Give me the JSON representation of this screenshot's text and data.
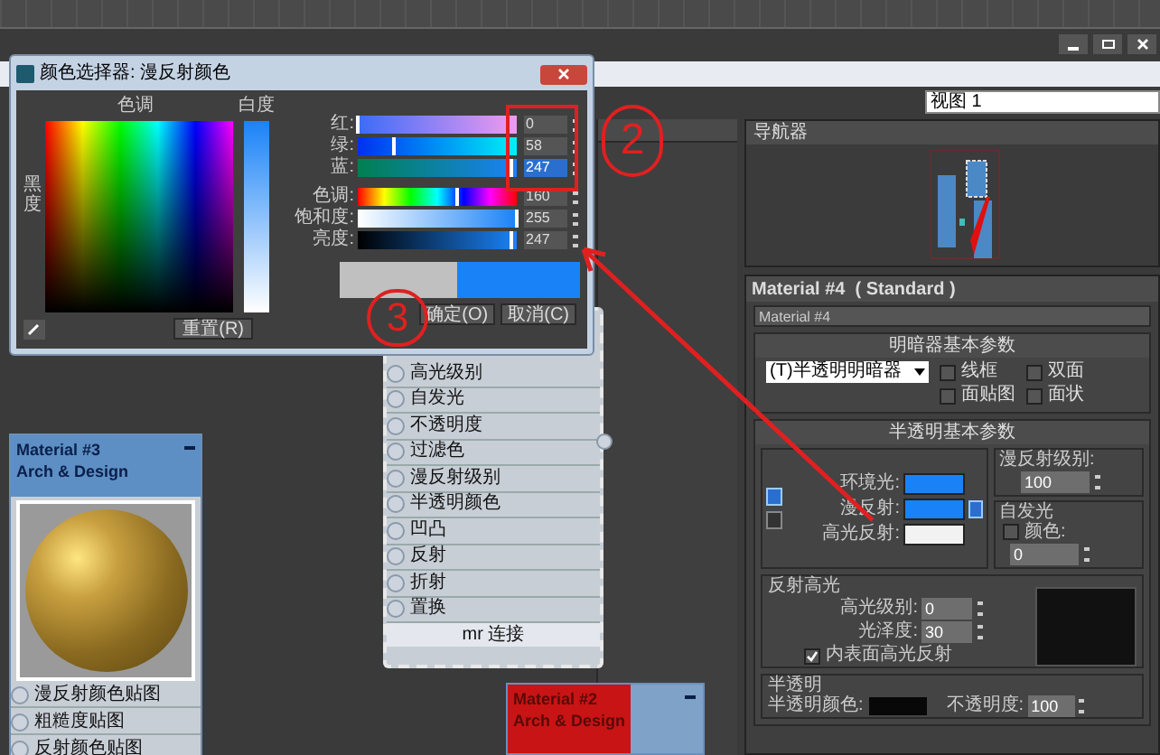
{
  "color_picker": {
    "title": "颜色选择器: 漫反射颜色",
    "hue_label": "色调",
    "whiteness_label": "白度",
    "blackness_label": "黑度",
    "reset": "重置(R)",
    "ok": "确定(O)",
    "cancel": "取消(C)",
    "channels": [
      {
        "label": "红:",
        "value": "0",
        "level": 0,
        "selected": false
      },
      {
        "label": "绿:",
        "value": "58",
        "level": 0.23,
        "selected": false
      },
      {
        "label": "蓝:",
        "value": "247",
        "level": 0.97,
        "selected": true
      },
      {
        "label": "色调:",
        "value": "160",
        "level": 0.63,
        "selected": false
      },
      {
        "label": "饱和度:",
        "value": "255",
        "level": 1,
        "selected": false
      },
      {
        "label": "亮度:",
        "value": "247",
        "level": 0.97,
        "selected": false
      }
    ]
  },
  "annotations": [
    "2",
    "3"
  ],
  "view_selector": "视图 1",
  "navigator": {
    "title": "导航器"
  },
  "material_panel": {
    "title": "Material #4  ( Standard )",
    "name": "Material #4",
    "shader_rollout": {
      "title": "明暗器基本参数",
      "shader": "(T)半透明明暗器",
      "options": [
        {
          "label": "线框",
          "checked": false
        },
        {
          "label": "双面",
          "checked": false
        },
        {
          "label": "面贴图",
          "checked": false
        },
        {
          "label": "面状",
          "checked": false
        }
      ]
    },
    "basic_rollout": {
      "title": "半透明基本参数",
      "colors": [
        {
          "label": "环境光:"
        },
        {
          "label": "漫反射:"
        },
        {
          "label": "高光反射:"
        }
      ],
      "diffuse_level_label": "漫反射级别:",
      "diffuse_level": "100",
      "self_illum_title": "自发光",
      "self_illum_color_label": "颜色:",
      "self_illum_checked": false,
      "self_illum_value": "0"
    },
    "specular": {
      "title": "反射高光",
      "level_label": "高光级别:",
      "level": "0",
      "gloss_label": "光泽度:",
      "gloss": "30",
      "backface_label": "内表面高光反射",
      "backface_checked": true
    },
    "translucency": {
      "title": "半透明",
      "color_label": "半透明颜色:",
      "opacity_label": "不透明度:",
      "opacity": "100"
    }
  },
  "node_material4": {
    "slots": [
      "高光级别",
      "自发光",
      "不透明度",
      "过滤色",
      "漫反射级别",
      "半透明颜色",
      "凹凸",
      "反射",
      "折射",
      "置换"
    ],
    "footer": "mr 连接"
  },
  "node_material3": {
    "title": "Material #3",
    "subtitle": "Arch & Design",
    "slots": [
      "漫反射颜色贴图",
      "粗糙度贴图",
      "反射颜色贴图"
    ]
  },
  "node_material2": {
    "title": "Material #2",
    "subtitle": "Arch & Design",
    "selected": true
  }
}
